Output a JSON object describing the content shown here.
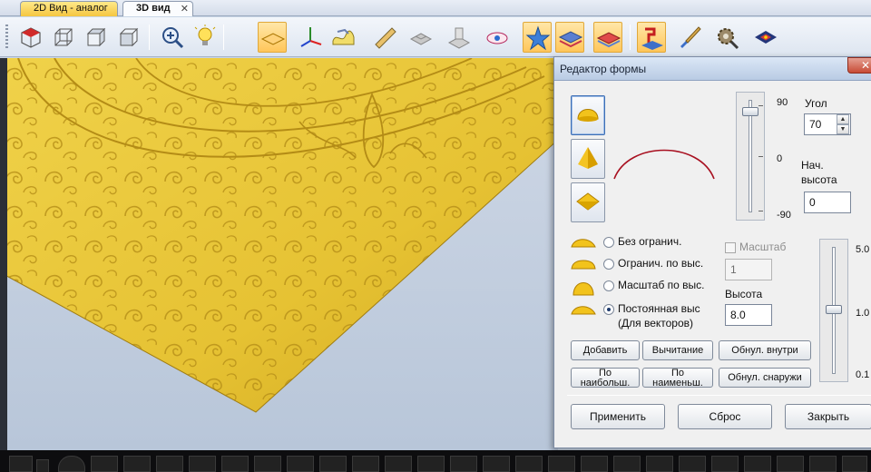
{
  "tabs": [
    {
      "label": "2D Вид - аналог",
      "active": false
    },
    {
      "label": "3D вид",
      "active": true,
      "close": "✕"
    }
  ],
  "toolbar": {
    "tools": [
      "view-iso-red-icon",
      "cube-wire-icon",
      "cube-front-icon",
      "cube-side-icon",
      "zoom-icon",
      "light-bulb-icon",
      "plane-view-icon",
      "axes-icon",
      "relief-icon",
      "chisel-icon",
      "mesh-icon",
      "surface-icon",
      "eye-icon",
      "star-icon",
      "layers-icon",
      "layers-flat-icon",
      "paint-icon",
      "brush-icon",
      "settings-icon",
      "hud-icon"
    ],
    "active": [
      6,
      13,
      14,
      15,
      16
    ]
  },
  "colors": {
    "gold": "#e8c736",
    "gold_dark": "#c49a16",
    "sky": "#c3d0e2",
    "accent": "#ffc65a"
  },
  "dialog": {
    "title": "Редактор формы",
    "close": "✕",
    "shape_buttons": [
      {
        "name": "dome-shape-icon",
        "selected": true
      },
      {
        "name": "pyramid-shape-icon",
        "selected": false
      },
      {
        "name": "diamond-shape-icon",
        "selected": false
      }
    ],
    "angle_slider": {
      "max_label": "90",
      "mid_label": "0",
      "min_label": "-90",
      "value": 70,
      "min": -90,
      "max": 90
    },
    "angle": {
      "label": "Угол",
      "value": "70"
    },
    "start_height": {
      "label_line1": "Нач.",
      "label_line2": "высота",
      "value": "0"
    },
    "scale_checkbox": {
      "label": "Масштаб",
      "checked": false,
      "enabled": false
    },
    "scale_value": "1",
    "height": {
      "label": "Высота",
      "value": "8.0"
    },
    "height_slider": {
      "max_label": "5.0",
      "mid_label": "1.0",
      "min_label": "0.1",
      "value": 1.0
    },
    "modes": [
      {
        "label": "Без огранич.",
        "checked": false
      },
      {
        "label": "Огранич. по выс.",
        "checked": false
      },
      {
        "label": "Масштаб по выс.",
        "checked": false
      },
      {
        "label": "Постоянная выс",
        "label2": "(Для векторов)",
        "checked": true
      }
    ],
    "buttons": {
      "add": "Добавить",
      "subtract": "Вычитание",
      "zero_inside": "Обнул. внутри",
      "by_max_line1": "По",
      "by_max_line2": "наибольш.",
      "by_min_line1": "По",
      "by_min_line2": "наименьш.",
      "zero_outside": "Обнул. снаружи",
      "apply": "Применить",
      "reset": "Сброс",
      "close": "Закрыть"
    }
  }
}
